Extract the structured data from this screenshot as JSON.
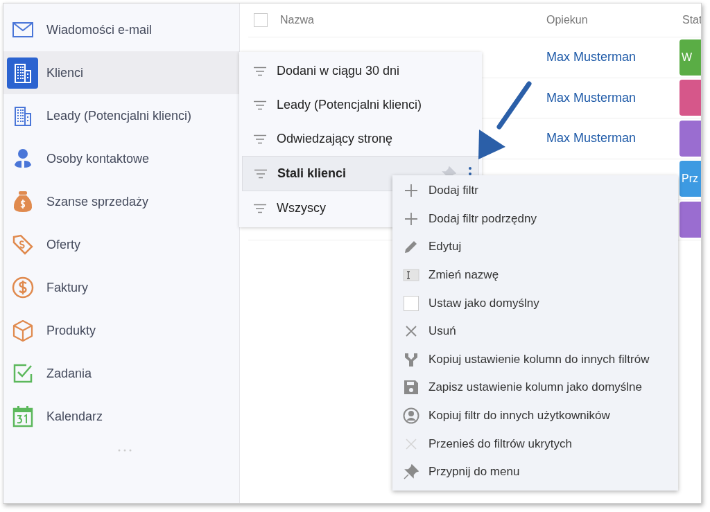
{
  "sidebar": {
    "items": [
      {
        "label": "Wiadomości e-mail",
        "selected": false
      },
      {
        "label": "Klienci",
        "selected": true
      },
      {
        "label": "Leady (Potencjalni klienci)",
        "selected": false
      },
      {
        "label": "Osoby kontaktowe",
        "selected": false
      },
      {
        "label": "Szanse sprzedaży",
        "selected": false
      },
      {
        "label": "Oferty",
        "selected": false
      },
      {
        "label": "Faktury",
        "selected": false
      },
      {
        "label": "Produkty",
        "selected": false
      },
      {
        "label": "Zadania",
        "selected": false
      },
      {
        "label": "Kalendarz",
        "selected": false
      }
    ]
  },
  "table": {
    "header_checkbox": {
      "checked": false
    },
    "columns": [
      "Nazwa",
      "Opiekun",
      "Stat"
    ],
    "rows": [
      {
        "owner": "Max Musterman",
        "status": "W",
        "color": "#5aad45"
      },
      {
        "owner": "Max Musterman",
        "status": "",
        "color": "#d6578a"
      },
      {
        "owner": "Max Musterman",
        "status": "",
        "color": "#9a6dd0"
      },
      {
        "owner": "",
        "status": "Prz",
        "color": "#3d9ae2"
      },
      {
        "owner": "",
        "status": "",
        "color": "#9a6dd0"
      }
    ]
  },
  "filters": [
    {
      "label": "Dodani w ciągu 30 dni",
      "selected": false
    },
    {
      "label": "Leady (Potencjalni klienci)",
      "selected": false
    },
    {
      "label": "Odwiedzający stronę",
      "selected": false
    },
    {
      "label": "Stali klienci",
      "selected": true
    },
    {
      "label": "Wszyscy",
      "selected": false
    }
  ],
  "context_menu": [
    {
      "kind": "action",
      "label": "Dodaj filtr"
    },
    {
      "kind": "action",
      "label": "Dodaj filtr podrzędny"
    },
    {
      "kind": "action",
      "label": "Edytuj"
    },
    {
      "kind": "action",
      "label": "Zmień nazwę"
    },
    {
      "kind": "checkbox",
      "label": "Ustaw jako domyślny",
      "checked": false
    },
    {
      "kind": "action",
      "label": "Usuń"
    },
    {
      "kind": "action",
      "label": "Kopiuj ustawienie kolumn do innych filtrów"
    },
    {
      "kind": "action",
      "label": "Zapisz ustawienie kolumn jako domyślne"
    },
    {
      "kind": "action",
      "label": "Kopiuj filtr do innych użytkowników"
    },
    {
      "kind": "action",
      "label": "Przenieś do filtrów ukrytych"
    },
    {
      "kind": "action",
      "label": "Przypnij do menu"
    }
  ]
}
